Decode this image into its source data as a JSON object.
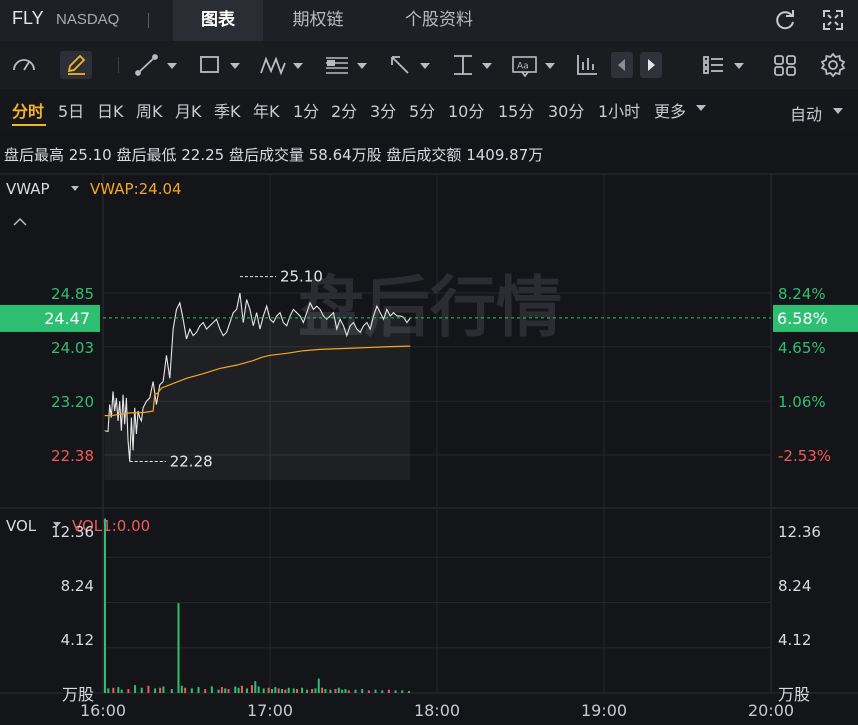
{
  "header": {
    "symbol": "FLY",
    "exchange": "NASDAQ",
    "tabs": [
      {
        "label": "图表",
        "active": true
      },
      {
        "label": "期权链",
        "active": false
      },
      {
        "label": "个股资料",
        "active": false
      }
    ]
  },
  "periods": {
    "items": [
      "分时",
      "5日",
      "日K",
      "周K",
      "月K",
      "季K",
      "年K",
      "1分",
      "2分",
      "3分",
      "5分",
      "10分",
      "15分",
      "30分",
      "1小时",
      "更多"
    ],
    "active": "分时",
    "auto_label": "自动"
  },
  "after_hours": {
    "text": "盘后最高 25.10 盘后最低 22.25 盘后成交量 58.64万股 盘后成交额 1409.87万"
  },
  "indicator": {
    "name": "VWAP",
    "value_label": "VWAP:24.04",
    "vol_name": "VOL",
    "vol_value_label": "VOL1:0.00",
    "vol_unit": "万股"
  },
  "watermark": "盘后行情",
  "current_price": {
    "price": "24.47",
    "percent": "6.58%"
  },
  "colors": {
    "up": "#2fbf72",
    "down": "#f05a5a",
    "vwap": "#f5a623",
    "active": "#f5b32c",
    "price_line": "#e6e6e6"
  },
  "chart_data": {
    "type": "line",
    "x_ticks": [
      "16:00",
      "17:00",
      "18:00",
      "19:00",
      "20:00"
    ],
    "price_axis_left": [
      {
        "label": "24.85",
        "value": 24.85,
        "dir": "up"
      },
      {
        "label": "24.03",
        "value": 24.03,
        "dir": "up"
      },
      {
        "label": "23.20",
        "value": 23.2,
        "dir": "up"
      },
      {
        "label": "22.38",
        "value": 22.38,
        "dir": "down"
      }
    ],
    "price_axis_right": [
      {
        "label": "8.24%",
        "value": 24.85,
        "dir": "up"
      },
      {
        "label": "4.65%",
        "value": 24.03,
        "dir": "up"
      },
      {
        "label": "1.06%",
        "value": 23.2,
        "dir": "up"
      },
      {
        "label": "-2.53%",
        "value": 22.38,
        "dir": "down"
      }
    ],
    "high_annotation": {
      "label": "25.10",
      "time": 0.82,
      "value": 25.1
    },
    "low_annotation": {
      "label": "22.28",
      "time": 0.16,
      "value": 22.28
    },
    "price_series": [
      [
        0.01,
        22.75
      ],
      [
        0.03,
        22.74
      ],
      [
        0.04,
        23.15
      ],
      [
        0.05,
        22.95
      ],
      [
        0.06,
        23.35
      ],
      [
        0.07,
        23.05
      ],
      [
        0.08,
        23.25
      ],
      [
        0.09,
        22.9
      ],
      [
        0.1,
        23.2
      ],
      [
        0.11,
        22.75
      ],
      [
        0.12,
        23.3
      ],
      [
        0.13,
        22.85
      ],
      [
        0.14,
        23.25
      ],
      [
        0.15,
        22.6
      ],
      [
        0.16,
        22.28
      ],
      [
        0.17,
        22.95
      ],
      [
        0.18,
        22.45
      ],
      [
        0.19,
        23.1
      ],
      [
        0.2,
        22.7
      ],
      [
        0.21,
        23.05
      ],
      [
        0.22,
        22.95
      ],
      [
        0.23,
        22.9
      ],
      [
        0.24,
        23.1
      ],
      [
        0.26,
        23.2
      ],
      [
        0.28,
        23.25
      ],
      [
        0.3,
        23.5
      ],
      [
        0.32,
        23.15
      ],
      [
        0.34,
        23.45
      ],
      [
        0.36,
        23.5
      ],
      [
        0.38,
        23.9
      ],
      [
        0.4,
        23.55
      ],
      [
        0.42,
        24.3
      ],
      [
        0.44,
        24.6
      ],
      [
        0.46,
        24.7
      ],
      [
        0.48,
        24.45
      ],
      [
        0.5,
        24.15
      ],
      [
        0.52,
        24.3
      ],
      [
        0.54,
        24.2
      ],
      [
        0.56,
        24.25
      ],
      [
        0.58,
        24.35
      ],
      [
        0.6,
        24.4
      ],
      [
        0.62,
        24.3
      ],
      [
        0.64,
        24.35
      ],
      [
        0.66,
        24.4
      ],
      [
        0.68,
        24.45
      ],
      [
        0.7,
        24.3
      ],
      [
        0.72,
        24.2
      ],
      [
        0.74,
        24.25
      ],
      [
        0.76,
        24.4
      ],
      [
        0.78,
        24.55
      ],
      [
        0.8,
        24.6
      ],
      [
        0.82,
        24.85
      ],
      [
        0.84,
        24.4
      ],
      [
        0.86,
        24.75
      ],
      [
        0.88,
        24.6
      ],
      [
        0.9,
        24.35
      ],
      [
        0.92,
        24.55
      ],
      [
        0.94,
        24.3
      ],
      [
        0.96,
        24.5
      ],
      [
        0.98,
        24.65
      ],
      [
        1.0,
        24.45
      ],
      [
        1.02,
        24.4
      ],
      [
        1.04,
        24.5
      ],
      [
        1.06,
        24.55
      ],
      [
        1.08,
        24.4
      ],
      [
        1.1,
        24.35
      ],
      [
        1.12,
        24.5
      ],
      [
        1.14,
        24.6
      ],
      [
        1.16,
        24.55
      ],
      [
        1.18,
        24.5
      ],
      [
        1.2,
        24.4
      ],
      [
        1.22,
        24.55
      ],
      [
        1.24,
        24.7
      ],
      [
        1.26,
        24.6
      ],
      [
        1.28,
        24.65
      ],
      [
        1.3,
        24.6
      ],
      [
        1.32,
        24.5
      ],
      [
        1.34,
        24.45
      ],
      [
        1.36,
        24.5
      ],
      [
        1.38,
        24.55
      ],
      [
        1.4,
        24.3
      ],
      [
        1.42,
        24.45
      ],
      [
        1.44,
        24.35
      ],
      [
        1.46,
        24.2
      ],
      [
        1.48,
        24.35
      ],
      [
        1.5,
        24.4
      ],
      [
        1.52,
        24.3
      ],
      [
        1.54,
        24.25
      ],
      [
        1.56,
        24.35
      ],
      [
        1.58,
        24.4
      ],
      [
        1.6,
        24.3
      ],
      [
        1.62,
        24.5
      ],
      [
        1.64,
        24.65
      ],
      [
        1.66,
        24.55
      ],
      [
        1.68,
        24.45
      ],
      [
        1.7,
        24.6
      ],
      [
        1.72,
        24.5
      ],
      [
        1.74,
        24.55
      ],
      [
        1.76,
        24.5
      ],
      [
        1.78,
        24.5
      ],
      [
        1.8,
        24.48
      ],
      [
        1.82,
        24.4
      ],
      [
        1.84,
        24.47
      ]
    ],
    "vwap_series": [
      [
        0.01,
        22.98
      ],
      [
        0.05,
        22.98
      ],
      [
        0.1,
        23.0
      ],
      [
        0.15,
        23.02
      ],
      [
        0.25,
        23.03
      ],
      [
        0.3,
        23.05
      ],
      [
        0.31,
        23.3
      ],
      [
        0.33,
        23.33
      ],
      [
        0.35,
        23.4
      ],
      [
        0.4,
        23.45
      ],
      [
        0.5,
        23.55
      ],
      [
        0.6,
        23.62
      ],
      [
        0.7,
        23.7
      ],
      [
        0.8,
        23.75
      ],
      [
        0.9,
        23.82
      ],
      [
        0.95,
        23.87
      ],
      [
        1.0,
        23.9
      ],
      [
        1.1,
        23.93
      ],
      [
        1.2,
        23.97
      ],
      [
        1.3,
        23.99
      ],
      [
        1.4,
        24.0
      ],
      [
        1.5,
        24.01
      ],
      [
        1.6,
        24.02
      ],
      [
        1.7,
        24.03
      ],
      [
        1.84,
        24.04
      ]
    ],
    "volume_axis": [
      "12.36",
      "8.24",
      "4.12"
    ],
    "volume_range": [
      0,
      13.8
    ],
    "volume": [
      [
        0.0,
        13.3,
        "up"
      ],
      [
        0.02,
        0.35,
        "up"
      ],
      [
        0.05,
        0.4,
        "down"
      ],
      [
        0.08,
        0.45,
        "up"
      ],
      [
        0.1,
        0.25,
        "up"
      ],
      [
        0.14,
        0.3,
        "down"
      ],
      [
        0.18,
        0.6,
        "up"
      ],
      [
        0.22,
        0.4,
        "up"
      ],
      [
        0.26,
        0.55,
        "down"
      ],
      [
        0.3,
        0.35,
        "up"
      ],
      [
        0.33,
        0.4,
        "down"
      ],
      [
        0.35,
        0.5,
        "up"
      ],
      [
        0.4,
        0.3,
        "up"
      ],
      [
        0.44,
        6.85,
        "up"
      ],
      [
        0.46,
        0.55,
        "up"
      ],
      [
        0.48,
        0.4,
        "down"
      ],
      [
        0.52,
        0.35,
        "up"
      ],
      [
        0.56,
        0.45,
        "up"
      ],
      [
        0.6,
        0.3,
        "down"
      ],
      [
        0.64,
        0.5,
        "up"
      ],
      [
        0.68,
        0.25,
        "up"
      ],
      [
        0.7,
        0.45,
        "down"
      ],
      [
        0.72,
        0.35,
        "up"
      ],
      [
        0.74,
        0.3,
        "down"
      ],
      [
        0.78,
        0.5,
        "up"
      ],
      [
        0.8,
        0.4,
        "up"
      ],
      [
        0.82,
        0.55,
        "down"
      ],
      [
        0.85,
        0.35,
        "up"
      ],
      [
        0.88,
        0.6,
        "down"
      ],
      [
        0.9,
        0.9,
        "up"
      ],
      [
        0.92,
        0.5,
        "up"
      ],
      [
        0.95,
        0.35,
        "up"
      ],
      [
        0.98,
        0.4,
        "down"
      ],
      [
        1.0,
        0.3,
        "up"
      ],
      [
        1.02,
        0.45,
        "up"
      ],
      [
        1.04,
        0.35,
        "down"
      ],
      [
        1.06,
        0.3,
        "up"
      ],
      [
        1.08,
        0.25,
        "down"
      ],
      [
        1.1,
        0.4,
        "up"
      ],
      [
        1.13,
        0.35,
        "up"
      ],
      [
        1.15,
        0.3,
        "down"
      ],
      [
        1.18,
        0.4,
        "up"
      ],
      [
        1.21,
        0.25,
        "up"
      ],
      [
        1.24,
        0.3,
        "down"
      ],
      [
        1.26,
        0.35,
        "up"
      ],
      [
        1.28,
        1.1,
        "up"
      ],
      [
        1.3,
        0.4,
        "down"
      ],
      [
        1.32,
        0.3,
        "up"
      ],
      [
        1.35,
        0.25,
        "up"
      ],
      [
        1.38,
        0.3,
        "down"
      ],
      [
        1.4,
        0.4,
        "up"
      ],
      [
        1.42,
        0.25,
        "up"
      ],
      [
        1.44,
        0.3,
        "up"
      ],
      [
        1.46,
        0.2,
        "down"
      ],
      [
        1.5,
        0.25,
        "up"
      ],
      [
        1.54,
        0.3,
        "up"
      ],
      [
        1.58,
        0.2,
        "down"
      ],
      [
        1.62,
        0.25,
        "up"
      ],
      [
        1.66,
        0.2,
        "up"
      ],
      [
        1.7,
        0.25,
        "down"
      ],
      [
        1.74,
        0.2,
        "up"
      ],
      [
        1.78,
        0.2,
        "up"
      ],
      [
        1.82,
        0.15,
        "up"
      ]
    ]
  }
}
